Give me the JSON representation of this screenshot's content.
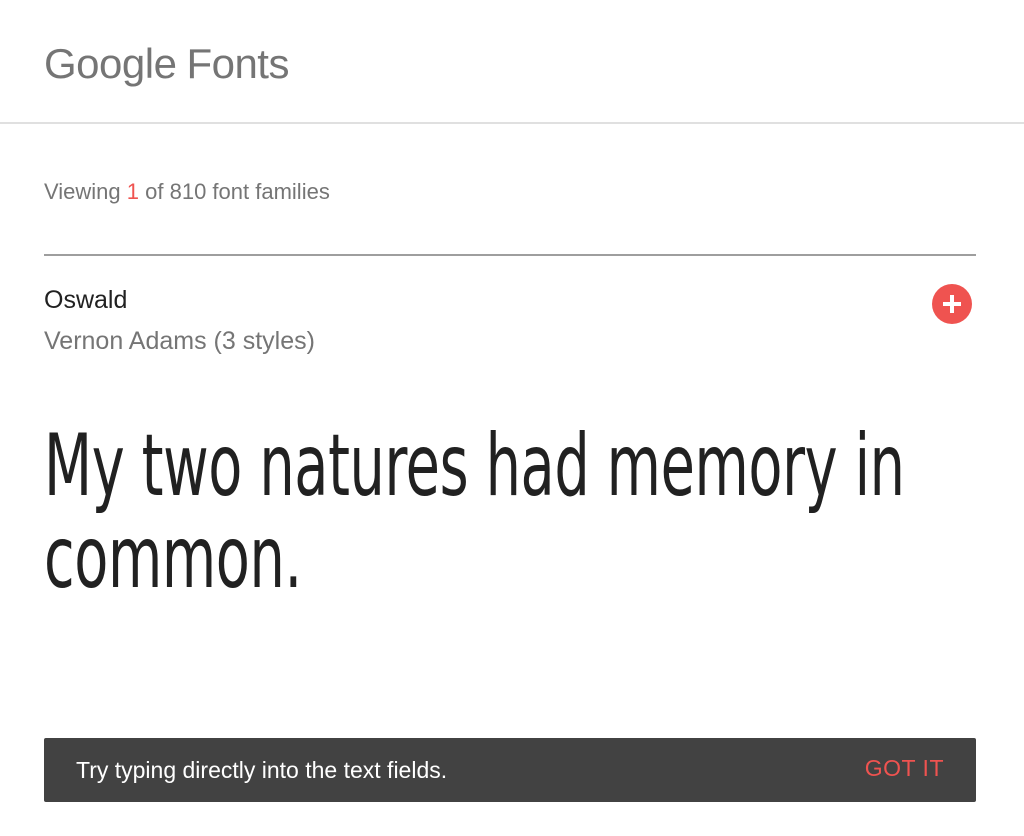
{
  "header": {
    "brand": "Google",
    "product": "Fonts"
  },
  "results": {
    "prefix": "Viewing",
    "count": "1",
    "suffix": "of 810 font families"
  },
  "font_card": {
    "family": "Oswald",
    "designer_styles": "Vernon Adams (3 styles)",
    "sample_text": "My two natures had memory in common.",
    "add_icon": "plus-circle-icon"
  },
  "snackbar": {
    "message": "Try typing directly into the text fields.",
    "action": "GOT IT"
  },
  "colors": {
    "accent": "#ef5350",
    "text_primary": "#212121",
    "text_secondary": "#757575",
    "snackbar_bg": "#424242"
  }
}
